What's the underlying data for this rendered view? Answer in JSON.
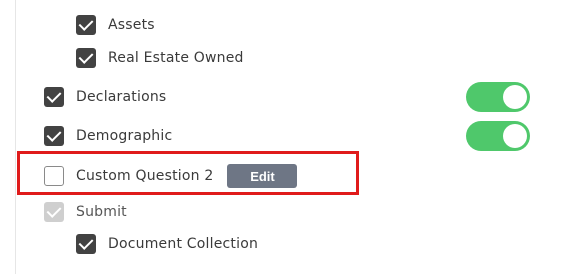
{
  "items": [
    {
      "label": "Assets",
      "checked": true
    },
    {
      "label": "Real Estate Owned",
      "checked": true
    },
    {
      "label": "Declarations",
      "checked": true,
      "toggle_on": true
    },
    {
      "label": "Demographic",
      "checked": true,
      "toggle_on": true
    },
    {
      "label": "Custom Question 2",
      "checked": false,
      "edit_label": "Edit"
    },
    {
      "label": "Submit",
      "checked": true,
      "disabled": true
    },
    {
      "label": "Document Collection",
      "checked": true
    }
  ],
  "colors": {
    "checkbox_checked": "#424242",
    "checkbox_disabled": "#cfcfcf",
    "toggle_on": "#4fc86b",
    "highlight_border": "#e01b1b",
    "edit_button": "#6e7685"
  }
}
